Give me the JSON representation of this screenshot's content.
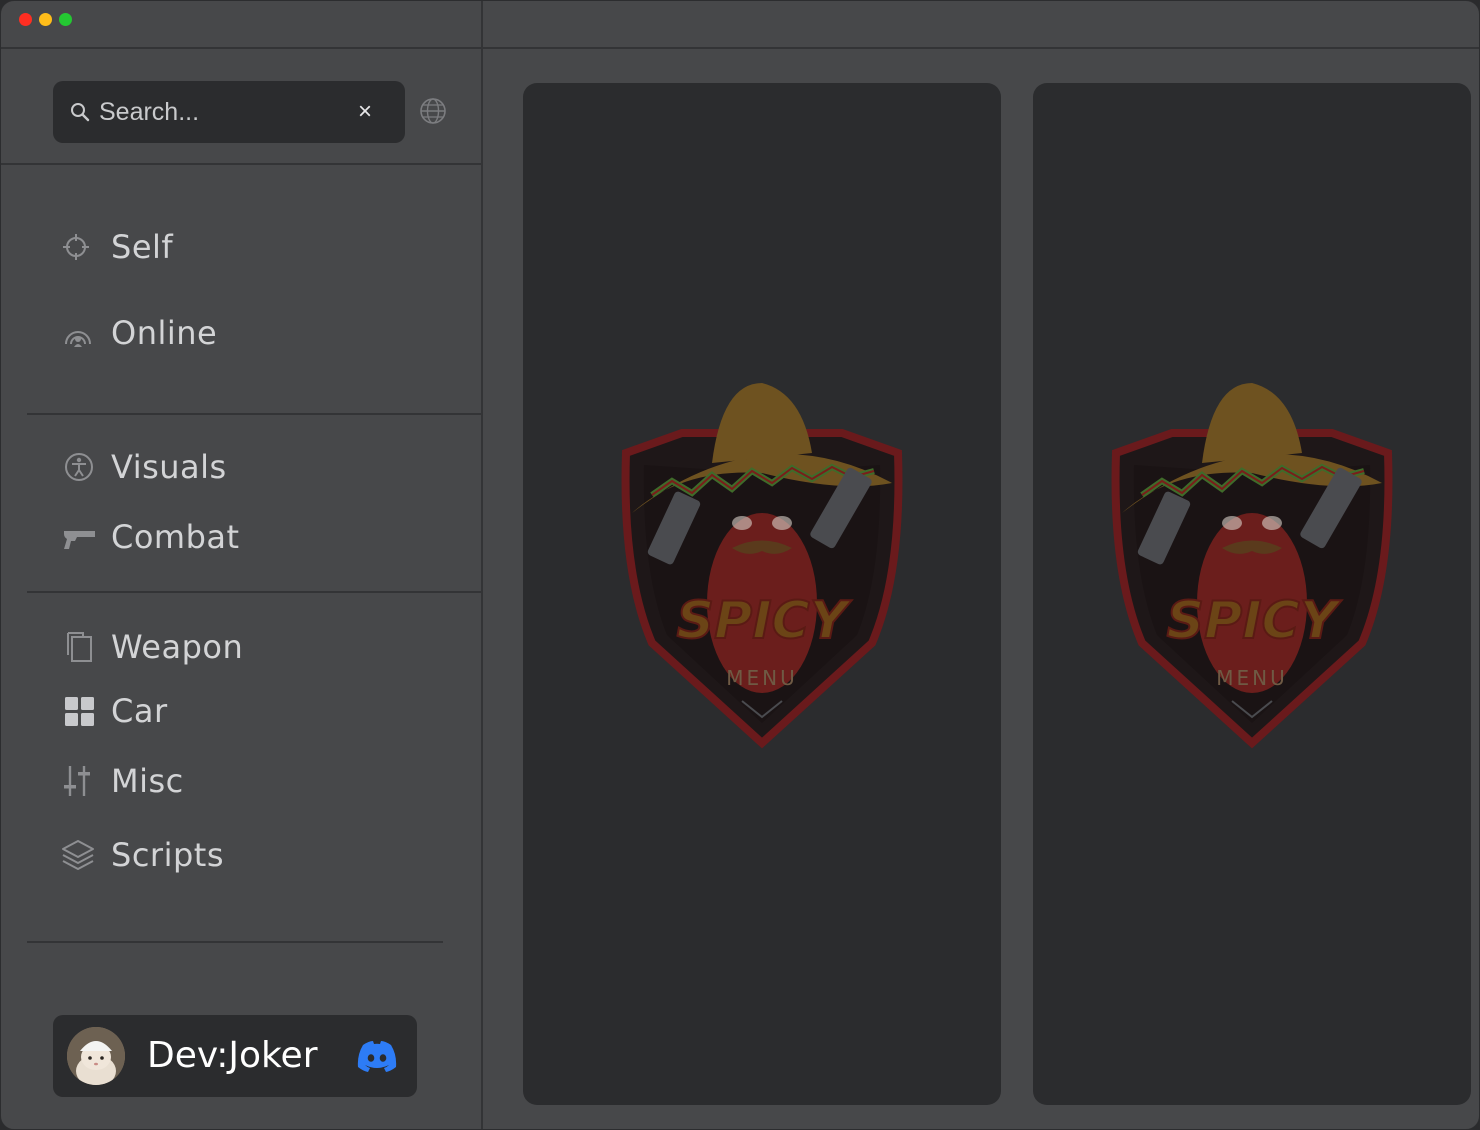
{
  "search": {
    "placeholder": "Search...",
    "clear_label": "×"
  },
  "nav": {
    "group1": [
      {
        "label": "Self",
        "icon": "crosshair-icon"
      },
      {
        "label": "Online",
        "icon": "broadcast-icon"
      }
    ],
    "group2": [
      {
        "label": "Visuals",
        "icon": "accessibility-icon"
      },
      {
        "label": "Combat",
        "icon": "pistol-icon"
      }
    ],
    "group3": [
      {
        "label": "Weapon",
        "icon": "copy-icon"
      },
      {
        "label": "Car",
        "icon": "grid-icon"
      },
      {
        "label": "Misc",
        "icon": "sliders-icon"
      },
      {
        "label": "Scripts",
        "icon": "layers-icon"
      }
    ]
  },
  "user": {
    "name": "Dev:Joker",
    "avatar": "cat-avatar",
    "badge": "discord-icon"
  },
  "logo": {
    "title": "SPICY",
    "subtitle": "MENU"
  },
  "colors": {
    "window": "#47484a",
    "panel": "#2b2c2e",
    "text": "#d3d4d6",
    "discord": "#2d7cf6"
  }
}
